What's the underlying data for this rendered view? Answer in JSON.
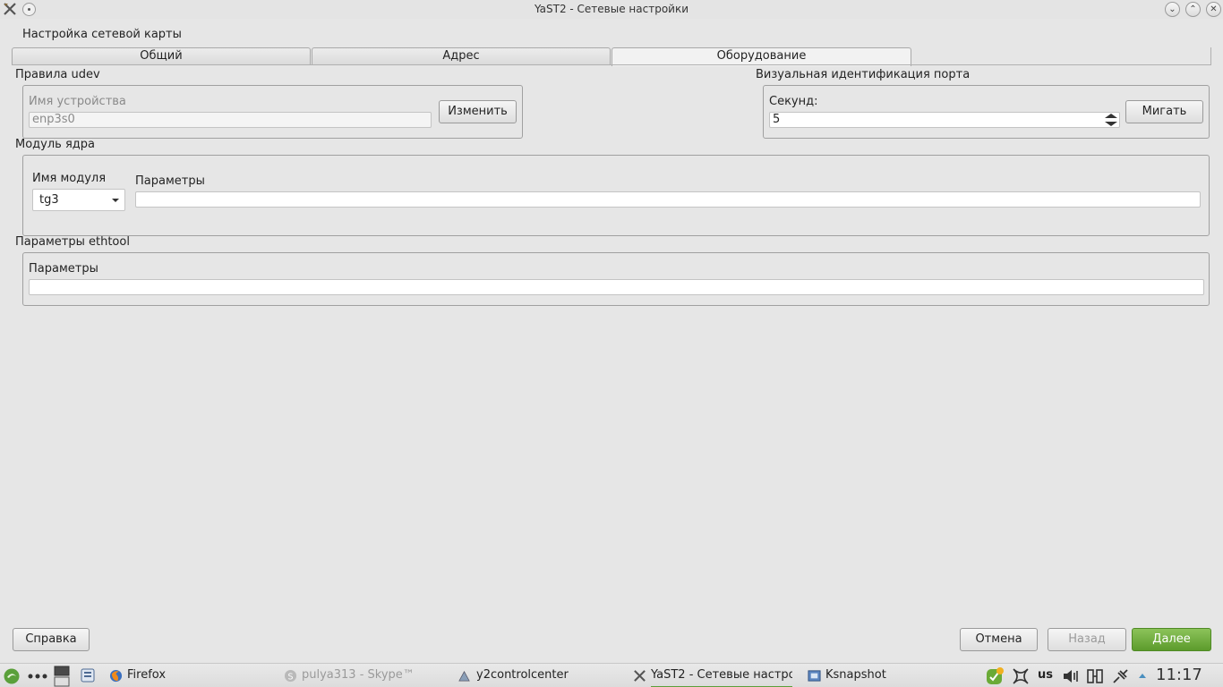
{
  "window": {
    "title": "YaST2 - Сетевые настройки",
    "controls": {
      "minimize": "⌄",
      "maximize": "⌃",
      "close": "✕"
    }
  },
  "dialog": {
    "title": "Настройка сетевой карты",
    "tabs": [
      {
        "label": "Общий",
        "active": false
      },
      {
        "label": "Адрес",
        "active": false
      },
      {
        "label": "Оборудование",
        "active": true
      }
    ]
  },
  "udev": {
    "group_label": "Правила udev",
    "device_name_label": "Имя устройства",
    "device_name_value": "enp3s0",
    "change_button": "Изменить"
  },
  "port_id": {
    "group_label": "Визуальная идентификация порта",
    "seconds_label": "Секунд:",
    "seconds_value": "5",
    "blink_button": "Мигать"
  },
  "kernel_module": {
    "group_label": "Модуль ядра",
    "module_name_label": "Имя модуля",
    "module_name_value": "tg3",
    "params_label": "Параметры",
    "params_value": ""
  },
  "ethtool": {
    "group_label": "Параметры ethtool",
    "params_label": "Параметры",
    "params_value": ""
  },
  "footer": {
    "help": "Справка",
    "cancel": "Отмена",
    "back": "Назад",
    "next": "Далее"
  },
  "taskbar": {
    "tasks": [
      {
        "label": "Firefox",
        "icon": "firefox-icon"
      },
      {
        "label": "pulya313 - Skype™",
        "icon": "skype-icon"
      },
      {
        "label": "y2controlcenter",
        "icon": "yast-icon"
      },
      {
        "label": "YaST2 - Сетевые настрой",
        "icon": "yast-icon"
      },
      {
        "label": "Ksnapshot",
        "icon": "ksnapshot-icon"
      }
    ],
    "keyboard_layout": "us",
    "clock": "11:17"
  },
  "colors": {
    "background": "#e6e6e6",
    "accent_green": "#6aaa36"
  }
}
